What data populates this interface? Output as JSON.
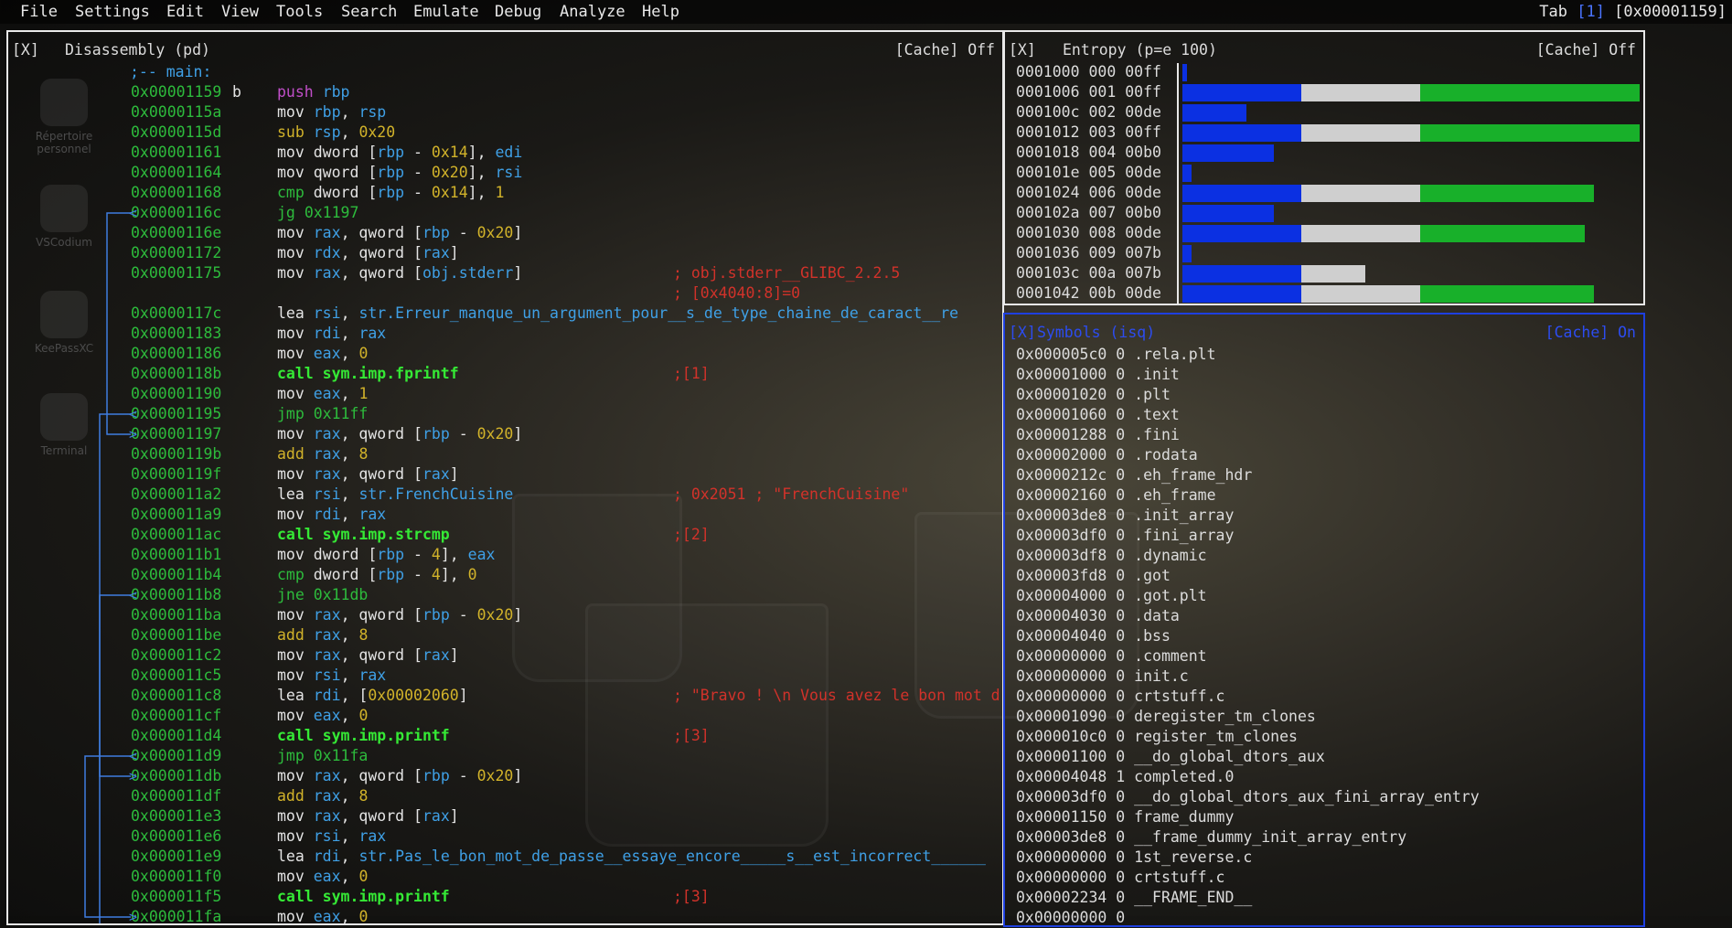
{
  "menu": [
    "File",
    "Settings",
    "Edit",
    "View",
    "Tools",
    "Search",
    "Emulate",
    "Debug",
    "Analyze",
    "Help"
  ],
  "tab_info": {
    "prefix": "Tab ",
    "num": "[1]",
    "addr": " [0x00001159]"
  },
  "desktop_icons": [
    "Répertoire personnel",
    "VSCodium",
    "KeePassXC",
    "Terminal"
  ],
  "disasm": {
    "close": "[X]",
    "title": "Disassembly (pd)",
    "cache": "[Cache] Off",
    "label": ";-- main:",
    "lines": [
      {
        "a": "0x00001159",
        "f": "b",
        "m": "push",
        "o": [
          [
            "reg",
            "rbp"
          ]
        ],
        "mc": "purple"
      },
      {
        "a": "0x0000115a",
        "m": "mov",
        "o": [
          [
            "reg",
            "rbp"
          ],
          [
            "txt",
            ", "
          ],
          [
            "reg",
            "rsp"
          ]
        ]
      },
      {
        "a": "0x0000115d",
        "m": "sub",
        "o": [
          [
            "reg",
            "rsp"
          ],
          [
            "txt",
            ", "
          ],
          [
            "num",
            "0x20"
          ]
        ],
        "mc": "yellow"
      },
      {
        "a": "0x00001161",
        "m": "mov",
        "o": [
          [
            "txt",
            "dword ["
          ],
          [
            "reg",
            "rbp"
          ],
          [
            "txt",
            " - "
          ],
          [
            "num",
            "0x14"
          ],
          [
            "txt",
            "], "
          ],
          [
            "reg",
            "edi"
          ]
        ]
      },
      {
        "a": "0x00001164",
        "m": "mov",
        "o": [
          [
            "txt",
            "qword ["
          ],
          [
            "reg",
            "rbp"
          ],
          [
            "txt",
            " - "
          ],
          [
            "num",
            "0x20"
          ],
          [
            "txt",
            "], "
          ],
          [
            "reg",
            "rsi"
          ]
        ]
      },
      {
        "a": "0x00001168",
        "m": "cmp",
        "o": [
          [
            "txt",
            "dword ["
          ],
          [
            "reg",
            "rbp"
          ],
          [
            "txt",
            " - "
          ],
          [
            "num",
            "0x14"
          ],
          [
            "txt",
            "], "
          ],
          [
            "num",
            "1"
          ]
        ],
        "mc": "cmpc"
      },
      {
        "a": "0x0000116c",
        "m": "jg",
        "o": [
          [
            "addr",
            "0x1197"
          ]
        ],
        "mc": "jmpc",
        "arr": "<"
      },
      {
        "a": "0x0000116e",
        "m": "mov",
        "o": [
          [
            "reg",
            "rax"
          ],
          [
            "txt",
            ", qword ["
          ],
          [
            "reg",
            "rbp"
          ],
          [
            "txt",
            " - "
          ],
          [
            "num",
            "0x20"
          ],
          [
            "txt",
            "]"
          ]
        ]
      },
      {
        "a": "0x00001172",
        "m": "mov",
        "o": [
          [
            "reg",
            "rdx"
          ],
          [
            "txt",
            ", qword ["
          ],
          [
            "reg",
            "rax"
          ],
          [
            "txt",
            "]"
          ]
        ]
      },
      {
        "a": "0x00001175",
        "m": "mov",
        "o": [
          [
            "reg",
            "rax"
          ],
          [
            "txt",
            ", qword ["
          ],
          [
            "reg",
            "obj.stderr"
          ],
          [
            "txt",
            "]"
          ]
        ],
        "c": "; obj.stderr__GLIBC_2.2.5"
      },
      {
        "a": "",
        "m": "",
        "o": [],
        "c": "; [0x4040:8]=0"
      },
      {
        "a": "0x0000117c",
        "m": "lea",
        "o": [
          [
            "reg",
            "rsi"
          ],
          [
            "txt",
            ", "
          ],
          [
            "reg",
            "str.Erreur_manque_un_argument_pour__s_de_type_chaine_de_caract__re"
          ]
        ]
      },
      {
        "a": "0x00001183",
        "m": "mov",
        "o": [
          [
            "reg",
            "rdi"
          ],
          [
            "txt",
            ", "
          ],
          [
            "reg",
            "rax"
          ]
        ]
      },
      {
        "a": "0x00001186",
        "m": "mov",
        "o": [
          [
            "reg",
            "eax"
          ],
          [
            "txt",
            ", "
          ],
          [
            "num",
            "0"
          ]
        ]
      },
      {
        "a": "0x0000118b",
        "m": "call sym.imp.fprintf",
        "o": [],
        "mc": "callc",
        "c": ";[1]"
      },
      {
        "a": "0x00001190",
        "m": "mov",
        "o": [
          [
            "reg",
            "eax"
          ],
          [
            "txt",
            ", "
          ],
          [
            "num",
            "1"
          ]
        ]
      },
      {
        "a": "0x00001195",
        "m": "jmp",
        "o": [
          [
            "addr",
            "0x11ff"
          ]
        ],
        "mc": "jmpc",
        "arr": "<"
      },
      {
        "a": "0x00001197",
        "m": "mov",
        "o": [
          [
            "reg",
            "rax"
          ],
          [
            "txt",
            ", qword ["
          ],
          [
            "reg",
            "rbp"
          ],
          [
            "txt",
            " - "
          ],
          [
            "num",
            "0x20"
          ],
          [
            "txt",
            "]"
          ]
        ],
        "arr": ">"
      },
      {
        "a": "0x0000119b",
        "m": "add",
        "o": [
          [
            "reg",
            "rax"
          ],
          [
            "txt",
            ", "
          ],
          [
            "num",
            "8"
          ]
        ],
        "mc": "yellow"
      },
      {
        "a": "0x0000119f",
        "m": "mov",
        "o": [
          [
            "reg",
            "rax"
          ],
          [
            "txt",
            ", qword ["
          ],
          [
            "reg",
            "rax"
          ],
          [
            "txt",
            "]"
          ]
        ]
      },
      {
        "a": "0x000011a2",
        "m": "lea",
        "o": [
          [
            "reg",
            "rsi"
          ],
          [
            "txt",
            ", "
          ],
          [
            "reg",
            "str.FrenchCuisine"
          ]
        ],
        "c": "; 0x2051 ; \"FrenchCuisine\""
      },
      {
        "a": "0x000011a9",
        "m": "mov",
        "o": [
          [
            "reg",
            "rdi"
          ],
          [
            "txt",
            ", "
          ],
          [
            "reg",
            "rax"
          ]
        ]
      },
      {
        "a": "0x000011ac",
        "m": "call sym.imp.strcmp",
        "o": [],
        "mc": "callc",
        "c": ";[2]"
      },
      {
        "a": "0x000011b1",
        "m": "mov",
        "o": [
          [
            "txt",
            "dword ["
          ],
          [
            "reg",
            "rbp"
          ],
          [
            "txt",
            " - "
          ],
          [
            "num",
            "4"
          ],
          [
            "txt",
            "], "
          ],
          [
            "reg",
            "eax"
          ]
        ]
      },
      {
        "a": "0x000011b4",
        "m": "cmp",
        "o": [
          [
            "txt",
            "dword ["
          ],
          [
            "reg",
            "rbp"
          ],
          [
            "txt",
            " - "
          ],
          [
            "num",
            "4"
          ],
          [
            "txt",
            "], "
          ],
          [
            "num",
            "0"
          ]
        ],
        "mc": "cmpc"
      },
      {
        "a": "0x000011b8",
        "m": "jne",
        "o": [
          [
            "addr",
            "0x11db"
          ]
        ],
        "mc": "jmpc",
        "arr": "<"
      },
      {
        "a": "0x000011ba",
        "m": "mov",
        "o": [
          [
            "reg",
            "rax"
          ],
          [
            "txt",
            ", qword ["
          ],
          [
            "reg",
            "rbp"
          ],
          [
            "txt",
            " - "
          ],
          [
            "num",
            "0x20"
          ],
          [
            "txt",
            "]"
          ]
        ]
      },
      {
        "a": "0x000011be",
        "m": "add",
        "o": [
          [
            "reg",
            "rax"
          ],
          [
            "txt",
            ", "
          ],
          [
            "num",
            "8"
          ]
        ],
        "mc": "yellow"
      },
      {
        "a": "0x000011c2",
        "m": "mov",
        "o": [
          [
            "reg",
            "rax"
          ],
          [
            "txt",
            ", qword ["
          ],
          [
            "reg",
            "rax"
          ],
          [
            "txt",
            "]"
          ]
        ]
      },
      {
        "a": "0x000011c5",
        "m": "mov",
        "o": [
          [
            "reg",
            "rsi"
          ],
          [
            "txt",
            ", "
          ],
          [
            "reg",
            "rax"
          ]
        ]
      },
      {
        "a": "0x000011c8",
        "m": "lea",
        "o": [
          [
            "reg",
            "rdi"
          ],
          [
            "txt",
            ", ["
          ],
          [
            "num",
            "0x00002060"
          ],
          [
            "txt",
            "]"
          ]
        ],
        "c": "; \"Bravo ! \\n Vous avez le bon mot d"
      },
      {
        "a": "0x000011cf",
        "m": "mov",
        "o": [
          [
            "reg",
            "eax"
          ],
          [
            "txt",
            ", "
          ],
          [
            "num",
            "0"
          ]
        ]
      },
      {
        "a": "0x000011d4",
        "m": "call sym.imp.printf",
        "o": [],
        "mc": "callc",
        "c": ";[3]"
      },
      {
        "a": "0x000011d9",
        "m": "jmp",
        "o": [
          [
            "addr",
            "0x11fa"
          ]
        ],
        "mc": "jmpc",
        "arr": "<"
      },
      {
        "a": "0x000011db",
        "m": "mov",
        "o": [
          [
            "reg",
            "rax"
          ],
          [
            "txt",
            ", qword ["
          ],
          [
            "reg",
            "rbp"
          ],
          [
            "txt",
            " - "
          ],
          [
            "num",
            "0x20"
          ],
          [
            "txt",
            "]"
          ]
        ],
        "arr": ">"
      },
      {
        "a": "0x000011df",
        "m": "add",
        "o": [
          [
            "reg",
            "rax"
          ],
          [
            "txt",
            ", "
          ],
          [
            "num",
            "8"
          ]
        ],
        "mc": "yellow"
      },
      {
        "a": "0x000011e3",
        "m": "mov",
        "o": [
          [
            "reg",
            "rax"
          ],
          [
            "txt",
            ", qword ["
          ],
          [
            "reg",
            "rax"
          ],
          [
            "txt",
            "]"
          ]
        ]
      },
      {
        "a": "0x000011e6",
        "m": "mov",
        "o": [
          [
            "reg",
            "rsi"
          ],
          [
            "txt",
            ", "
          ],
          [
            "reg",
            "rax"
          ]
        ]
      },
      {
        "a": "0x000011e9",
        "m": "lea",
        "o": [
          [
            "reg",
            "rdi"
          ],
          [
            "txt",
            ", "
          ],
          [
            "reg",
            "str.Pas_le_bon_mot_de_passe__essaye_encore_____s__est_incorrect______"
          ]
        ]
      },
      {
        "a": "0x000011f0",
        "m": "mov",
        "o": [
          [
            "reg",
            "eax"
          ],
          [
            "txt",
            ", "
          ],
          [
            "num",
            "0"
          ]
        ]
      },
      {
        "a": "0x000011f5",
        "m": "call sym.imp.printf",
        "o": [],
        "mc": "callc",
        "c": ";[3]"
      },
      {
        "a": "0x000011fa",
        "m": "mov",
        "o": [
          [
            "reg",
            "eax"
          ],
          [
            "txt",
            ", "
          ],
          [
            "num",
            "0"
          ]
        ],
        "arr": ">"
      }
    ]
  },
  "entropy": {
    "close": "[X]",
    "title": "Entropy (p=e 100)",
    "cache": "[Cache] Off",
    "rows": [
      {
        "label": "0001000 000 00ff",
        "blue": 0.01,
        "white": 0,
        "green": 0
      },
      {
        "label": "0001006 001 00ff",
        "blue": 0.26,
        "white": 0.26,
        "green": 0.48
      },
      {
        "label": "000100c 002 00de",
        "blue": 0.14,
        "white": 0,
        "green": 0
      },
      {
        "label": "0001012 003 00ff",
        "blue": 0.26,
        "white": 0.26,
        "green": 0.48
      },
      {
        "label": "0001018 004 00b0",
        "blue": 0.2,
        "white": 0,
        "green": 0
      },
      {
        "label": "000101e 005 00de",
        "blue": 0.02,
        "white": 0,
        "green": 0
      },
      {
        "label": "0001024 006 00de",
        "blue": 0.26,
        "white": 0.26,
        "green": 0.38
      },
      {
        "label": "000102a 007 00b0",
        "blue": 0.2,
        "white": 0,
        "green": 0
      },
      {
        "label": "0001030 008 00de",
        "blue": 0.26,
        "white": 0.26,
        "green": 0.36
      },
      {
        "label": "0001036 009 007b",
        "blue": 0.02,
        "white": 0,
        "green": 0
      },
      {
        "label": "000103c 00a 007b",
        "blue": 0.26,
        "white": 0.14,
        "green": 0
      },
      {
        "label": "0001042 00b 00de",
        "blue": 0.26,
        "white": 0.26,
        "green": 0.38
      }
    ]
  },
  "symbols": {
    "close": "[X]",
    "title": "Symbols (isq)",
    "cache": "[Cache] On",
    "rows": [
      "0x000005c0 0 .rela.plt",
      "0x00001000 0 .init",
      "0x00001020 0 .plt",
      "0x00001060 0 .text",
      "0x00001288 0 .fini",
      "0x00002000 0 .rodata",
      "0x0000212c 0 .eh_frame_hdr",
      "0x00002160 0 .eh_frame",
      "0x00003de8 0 .init_array",
      "0x00003df0 0 .fini_array",
      "0x00003df8 0 .dynamic",
      "0x00003fd8 0 .got",
      "0x00004000 0 .got.plt",
      "0x00004030 0 .data",
      "0x00004040 0 .bss",
      "0x00000000 0 .comment",
      "0x00000000 0 init.c",
      "0x00000000 0 crtstuff.c",
      "0x00001090 0 deregister_tm_clones",
      "0x000010c0 0 register_tm_clones",
      "0x00001100 0 __do_global_dtors_aux",
      "0x00004048 1 completed.0",
      "0x00003df0 0 __do_global_dtors_aux_fini_array_entry",
      "0x00001150 0 frame_dummy",
      "0x00003de8 0 __frame_dummy_init_array_entry",
      "0x00000000 0 1st_reverse.c",
      "0x00000000 0 crtstuff.c",
      "0x00002234 0 __FRAME_END__",
      "0x00000000 0"
    ]
  }
}
